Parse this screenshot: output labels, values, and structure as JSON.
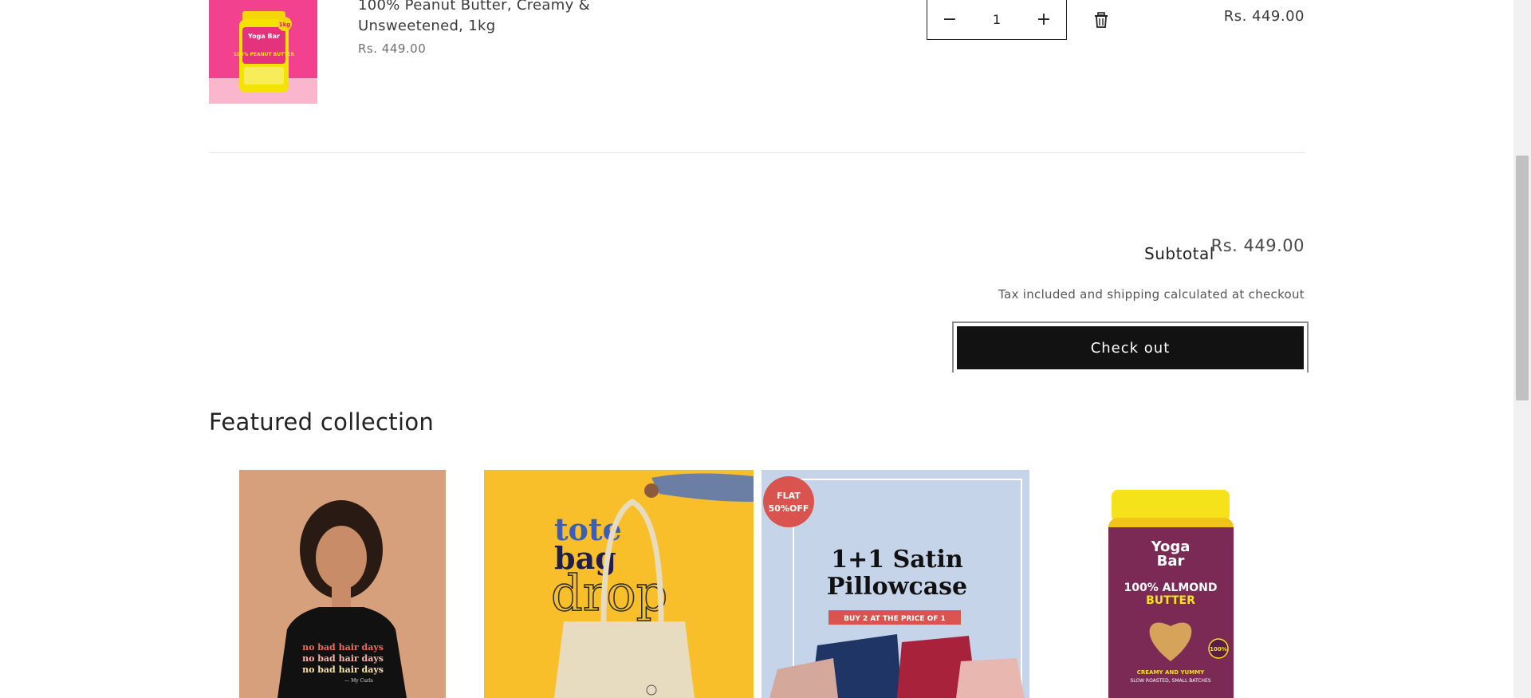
{
  "cart_item": {
    "title": "100% Peanut Butter, Creamy & Unsweetened, 1kg",
    "price": "Rs. 449.00",
    "quantity": "1",
    "decrease_symbol": "−",
    "increase_symbol": "+",
    "line_total": "Rs. 449.00",
    "image_text": {
      "brand": "Yoga Bar",
      "headline": "100% PEANUT BUTTER",
      "badge": "1kg"
    }
  },
  "summary": {
    "subtotal_label": "Subtotal",
    "subtotal_value": "Rs. 449.00",
    "tax_note": "Tax included and shipping calculated at checkout",
    "checkout_label": "Check out"
  },
  "featured": {
    "title": "Featured collection",
    "cards": [
      {
        "shirt_lines": [
          "no bad hair days",
          "no bad hair days",
          "no bad hair days"
        ],
        "shirt_signature": "— My Curls"
      },
      {
        "word1": "tote",
        "word2": "bag",
        "word3": "drop"
      },
      {
        "badge_line1": "FLAT",
        "badge_line2": "50%OFF",
        "title_line1": "1+1 Satin",
        "title_line2": "Pillowcase",
        "tag": "BUY 2 AT THE PRICE OF 1"
      },
      {
        "brand_line1": "Yoga",
        "brand_line2": "Bar",
        "headline1": "100% ALMOND",
        "headline2": "BUTTER",
        "sub1": "CREAMY AND YUMMY",
        "sub2": "SLOW ROASTED, SMALL BATCHES",
        "seal": "100%"
      }
    ]
  },
  "colors": {
    "button_bg": "#121212",
    "item_image_pink": "#f2418f",
    "tote_bg": "#f9bf2a",
    "pillow_bg": "#c6d4ea",
    "almond_label": "#7b2a55"
  }
}
